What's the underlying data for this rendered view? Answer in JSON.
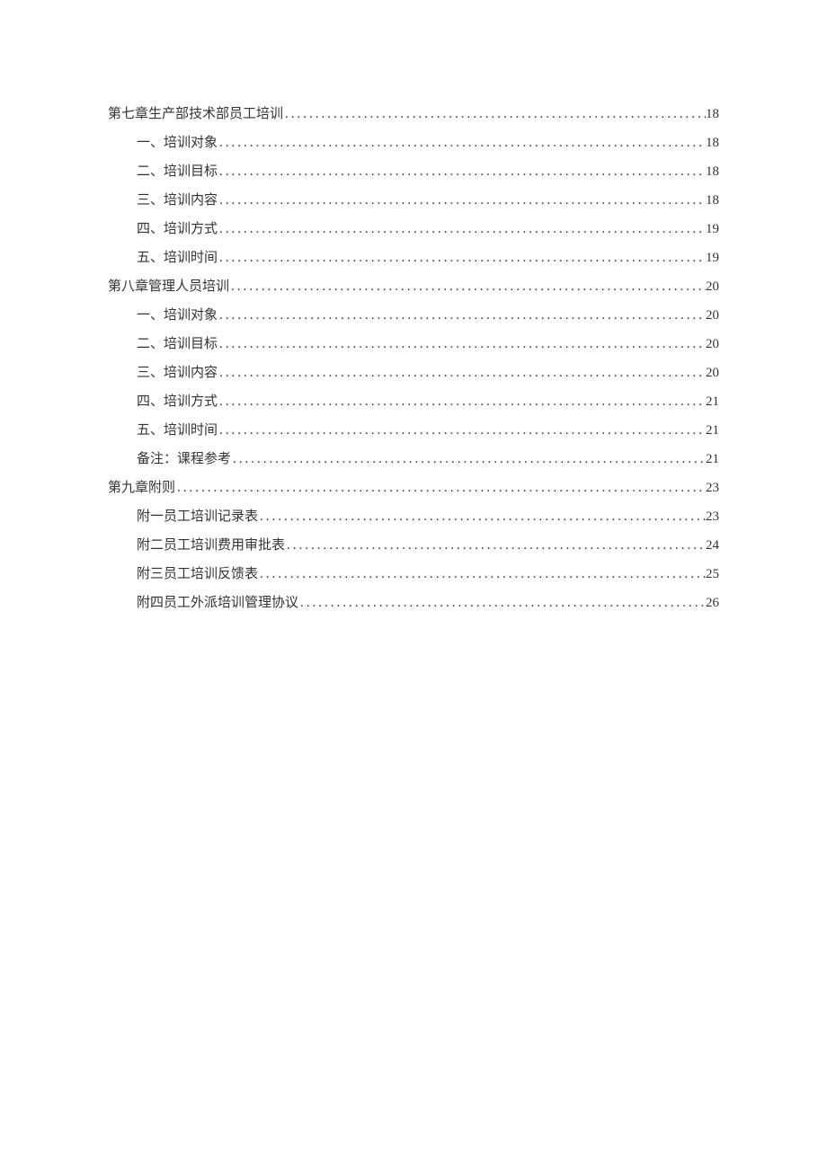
{
  "toc": [
    {
      "level": 1,
      "title": "第七章生产部技术部员工培训",
      "page": "18"
    },
    {
      "level": 2,
      "title": "一、培训对象",
      "page": "18"
    },
    {
      "level": 2,
      "title": "二、培训目标",
      "page": "18"
    },
    {
      "level": 2,
      "title": "三、培训内容",
      "page": "18"
    },
    {
      "level": 2,
      "title": "四、培训方式",
      "page": "19"
    },
    {
      "level": 2,
      "title": "五、培训时间",
      "page": "19"
    },
    {
      "level": 1,
      "title": "第八章管理人员培训",
      "page": "20"
    },
    {
      "level": 2,
      "title": "一、培训对象",
      "page": "20"
    },
    {
      "level": 2,
      "title": "二、培训目标",
      "page": "20"
    },
    {
      "level": 2,
      "title": "三、培训内容",
      "page": "20"
    },
    {
      "level": 2,
      "title": "四、培训方式",
      "page": "21"
    },
    {
      "level": 2,
      "title": "五、培训时间",
      "page": "21"
    },
    {
      "level": 2,
      "title": "备注：课程参考",
      "page": "21"
    },
    {
      "level": 1,
      "title": "第九章附则",
      "page": "23"
    },
    {
      "level": 2,
      "title": "附一员工培训记录表",
      "page": "23"
    },
    {
      "level": 2,
      "title": "附二员工培训费用审批表",
      "page": "24"
    },
    {
      "level": 2,
      "title": "附三员工培训反馈表",
      "page": "25"
    },
    {
      "level": 2,
      "title": "附四员工外派培训管理协议",
      "page": "26"
    }
  ]
}
